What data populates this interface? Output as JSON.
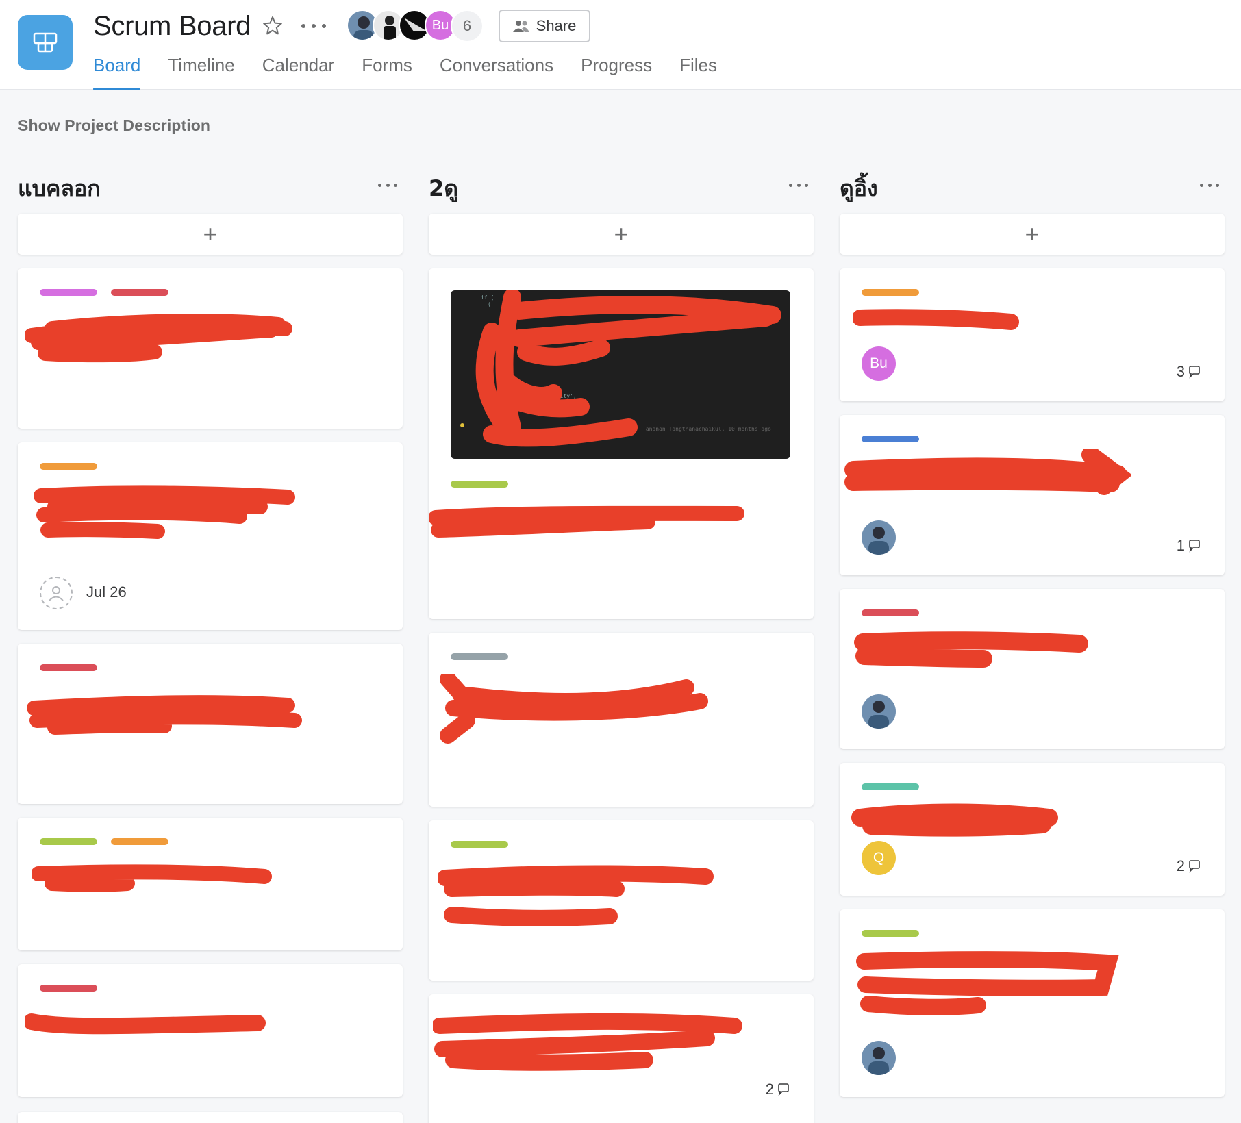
{
  "header": {
    "title": "Scrum Board",
    "member_count": "6",
    "avatar_initials": "Bu",
    "share_label": "Share",
    "icon": "board-icon"
  },
  "tabs": [
    "Board",
    "Timeline",
    "Calendar",
    "Forms",
    "Conversations",
    "Progress",
    "Files"
  ],
  "active_tab": "Board",
  "show_description": "Show Project Description",
  "add_symbol": "+",
  "columns": [
    {
      "title": "แบคลอก",
      "cards": [
        {
          "tags": [
            "#d56ee0",
            "#db4e58"
          ]
        },
        {
          "tags": [
            "#f09b3a"
          ],
          "due": "Jul 26"
        },
        {
          "tags": [
            "#db4e58"
          ]
        },
        {
          "tags": [
            "#a8c94a",
            "#f09b3a"
          ]
        },
        {
          "tags": [
            "#db4e58"
          ]
        }
      ]
    },
    {
      "title": "2ดู",
      "cards": [
        {
          "tags": [
            "#a8c94a"
          ],
          "image": "code-screenshot",
          "code_caption": "Tananan Tangthanachaikul, 10 months ago"
        },
        {
          "tags": [
            "#95a2a8"
          ]
        },
        {
          "tags": [
            "#a8c94a"
          ]
        },
        {
          "tags": [],
          "comments": "2"
        }
      ]
    },
    {
      "title": "ดูอิ้ง",
      "cards": [
        {
          "tags": [
            "#f09b3a"
          ],
          "assignee": "Bu",
          "assignee_color": "#d56ee0",
          "comments": "3"
        },
        {
          "tags": [
            "#4a7fd4"
          ],
          "assignee_photo": true,
          "comments": "1"
        },
        {
          "tags": [
            "#db4e58"
          ],
          "assignee_photo": true
        },
        {
          "tags": [
            "#5cc3a8"
          ],
          "assignee": "Q",
          "assignee_color": "#eec43a",
          "comments": "2"
        },
        {
          "tags": [
            "#a8c94a"
          ],
          "assignee_photo": true
        }
      ]
    }
  ],
  "colors": {
    "accent": "#2f8ad6",
    "redaction": "#e8402a",
    "app_icon": "#4ba3e2"
  }
}
